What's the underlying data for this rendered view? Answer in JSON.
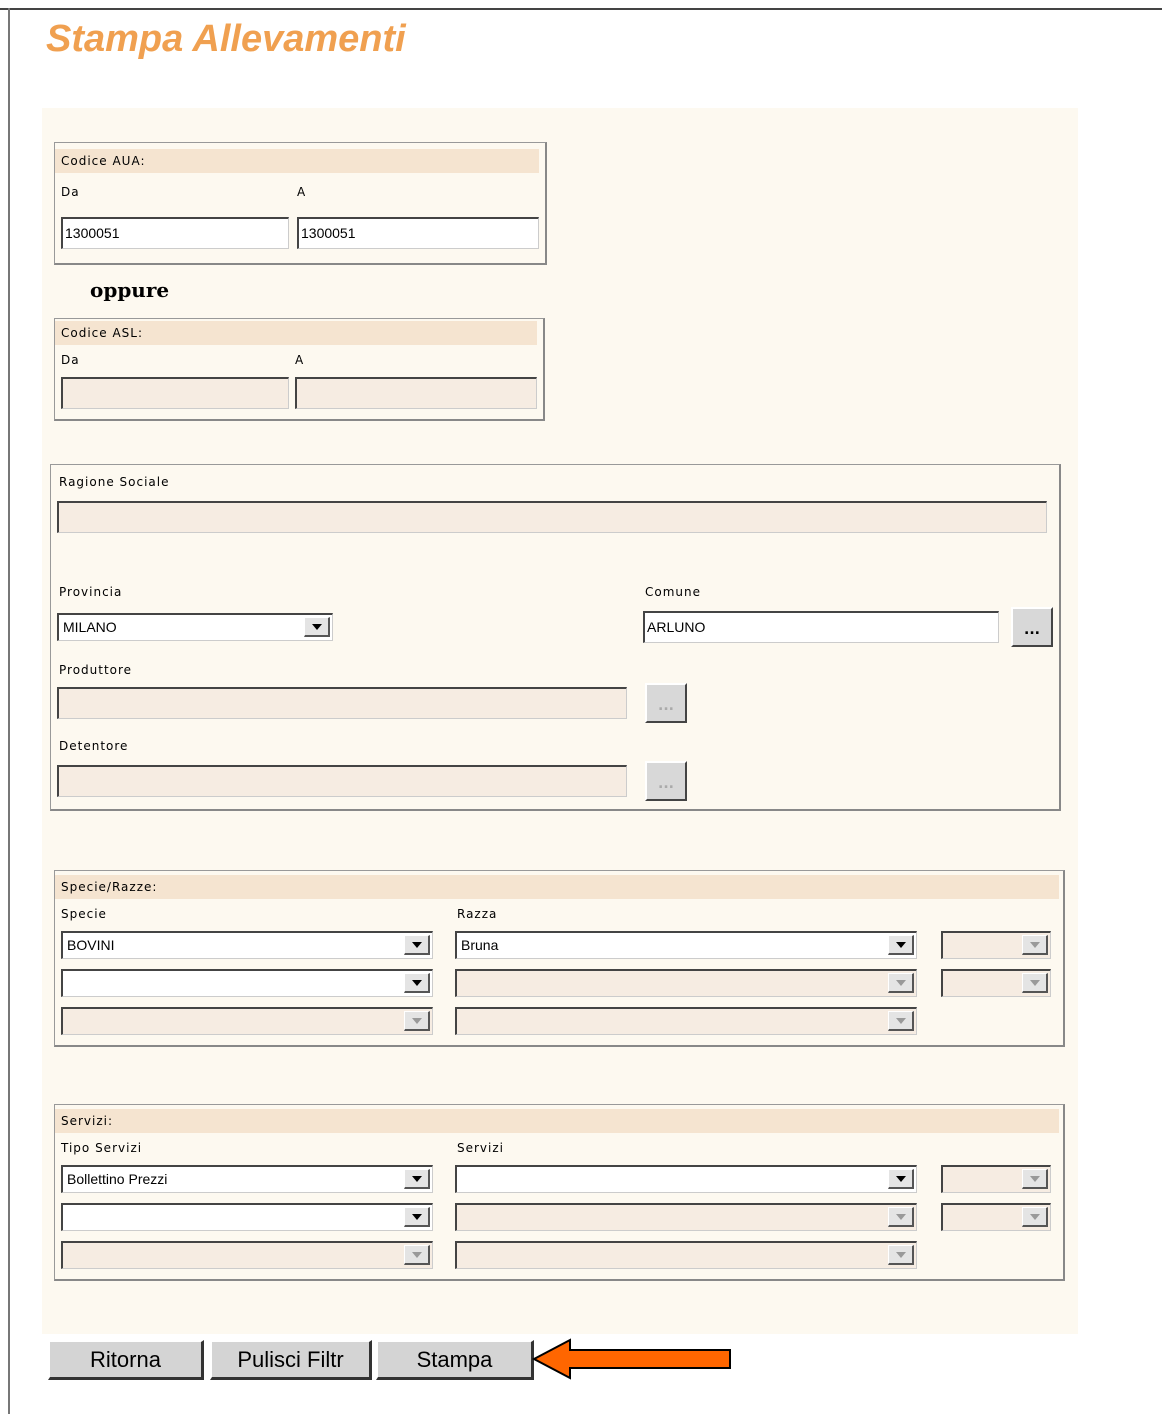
{
  "page": {
    "title": "Stampa Allevamenti"
  },
  "codice_aua": {
    "header": "Codice AUA:",
    "da_label": "Da",
    "a_label": "A",
    "da_value": "1300051",
    "a_value": "1300051"
  },
  "oppure": "oppure",
  "codice_asl": {
    "header": "Codice ASL:",
    "da_label": "Da",
    "a_label": "A",
    "da_value": "",
    "a_value": ""
  },
  "anagrafica": {
    "ragione_sociale_label": "Ragione Sociale",
    "ragione_sociale_value": "",
    "provincia_label": "Provincia",
    "provincia_value": "MILANO",
    "comune_label": "Comune",
    "comune_value": "ARLUNO",
    "produttore_label": "Produttore",
    "produttore_value": "",
    "detentore_label": "Detentore",
    "detentore_value": "",
    "browse_label": "..."
  },
  "specie_razze": {
    "header": "Specie/Razze:",
    "specie_label": "Specie",
    "razza_label": "Razza",
    "specie": [
      "BOVINI",
      "",
      ""
    ],
    "razza": [
      "Bruna",
      "",
      ""
    ]
  },
  "servizi": {
    "header": "Servizi:",
    "tipo_label": "Tipo Servizi",
    "servizi_label": "Servizi",
    "tipo": [
      "Bollettino Prezzi",
      "",
      ""
    ],
    "servizi": [
      "",
      "",
      ""
    ]
  },
  "buttons": {
    "ritorna": "Ritorna",
    "pulisci": "Pulisci Filtr",
    "stampa": "Stampa"
  },
  "colors": {
    "title": "#f0a050",
    "arrow": "#ff6600",
    "panel": "#fdf9f0",
    "header_band": "#f5e4d0"
  }
}
